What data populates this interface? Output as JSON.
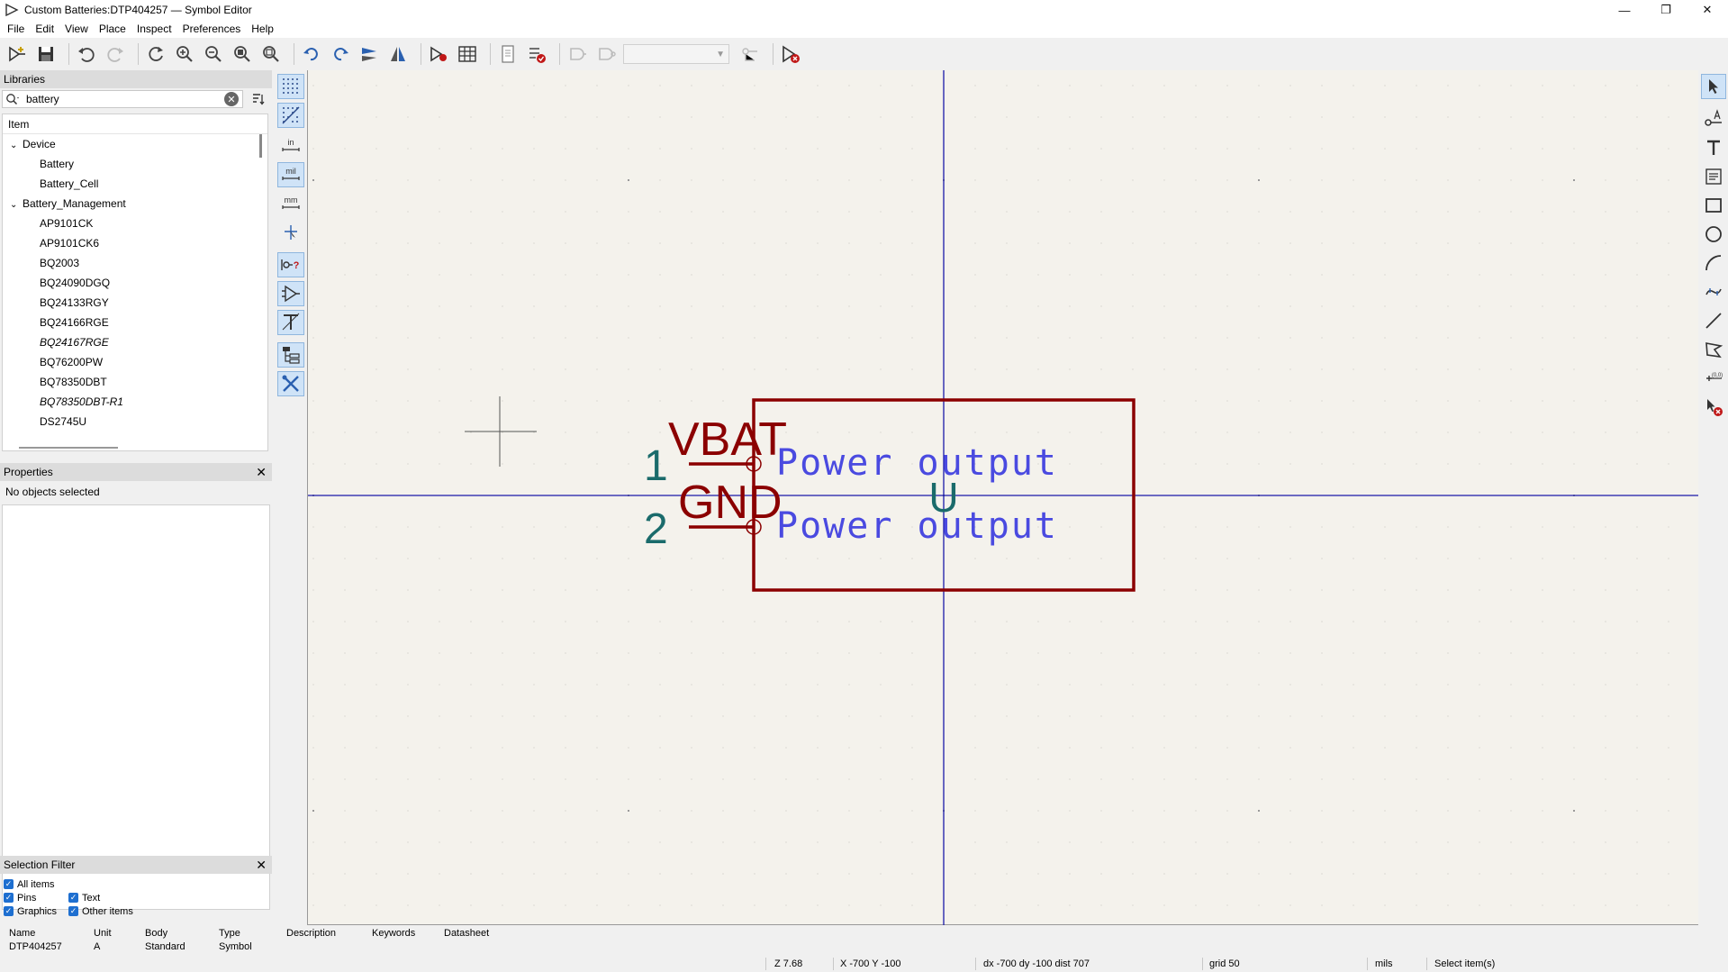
{
  "window": {
    "title": "Custom Batteries:DTP404257 — Symbol Editor",
    "minimize": "—",
    "maximize": "❐",
    "close": "✕"
  },
  "menu": [
    "File",
    "Edit",
    "View",
    "Place",
    "Inspect",
    "Preferences",
    "Help"
  ],
  "libraries": {
    "header": "Libraries",
    "search_value": "battery",
    "clear": "✕",
    "column_header": "Item",
    "groups": [
      {
        "name": "Device",
        "items": [
          {
            "label": "Battery",
            "italic": false
          },
          {
            "label": "Battery_Cell",
            "italic": false
          }
        ]
      },
      {
        "name": "Battery_Management",
        "items": [
          {
            "label": "AP9101CK",
            "italic": false
          },
          {
            "label": "AP9101CK6",
            "italic": false
          },
          {
            "label": "BQ2003",
            "italic": false
          },
          {
            "label": "BQ24090DGQ",
            "italic": false
          },
          {
            "label": "BQ24133RGY",
            "italic": false
          },
          {
            "label": "BQ24166RGE",
            "italic": false
          },
          {
            "label": "BQ24167RGE",
            "italic": true
          },
          {
            "label": "BQ76200PW",
            "italic": false
          },
          {
            "label": "BQ78350DBT",
            "italic": false
          },
          {
            "label": "BQ78350DBT-R1",
            "italic": true
          },
          {
            "label": "DS2745U",
            "italic": false
          }
        ]
      }
    ]
  },
  "properties": {
    "header": "Properties",
    "close": "✕",
    "status": "No objects selected"
  },
  "selection_filter": {
    "header": "Selection Filter",
    "close": "✕",
    "items": {
      "all": "All items",
      "pins": "Pins",
      "text": "Text",
      "graphics": "Graphics",
      "other": "Other items"
    }
  },
  "left_tools": {
    "units_in": "in",
    "units_mil": "mil",
    "units_mm": "mm"
  },
  "symbol": {
    "reference": "U",
    "pins": [
      {
        "number": "1",
        "name": "VBAT",
        "type": "Power output"
      },
      {
        "number": "2",
        "name": "GND",
        "type": "Power output"
      }
    ]
  },
  "message_panel": {
    "name_label": "Name",
    "name_value": "DTP404257",
    "unit_label": "Unit",
    "unit_value": "A",
    "body_label": "Body",
    "body_value": "Standard",
    "type_label": "Type",
    "type_value": "Symbol",
    "description_label": "Description",
    "keywords_label": "Keywords",
    "datasheet_label": "Datasheet"
  },
  "status_bar": {
    "zoom": "Z 7.68",
    "xy": "X -700  Y -100",
    "delta": "dx -700  dy -100  dist 707",
    "grid": "grid 50",
    "units": "mils",
    "tool": "Select item(s)"
  },
  "colors": {
    "canvas_bg": "#f4f2ec",
    "axis": "#1a1aa8",
    "body_outline": "#8b0000",
    "pin_number": "#1a6b6b",
    "pin_type": "#4a4ae0",
    "active_tool_bg": "#cfe3f7",
    "checkbox": "#1e6fd0"
  }
}
